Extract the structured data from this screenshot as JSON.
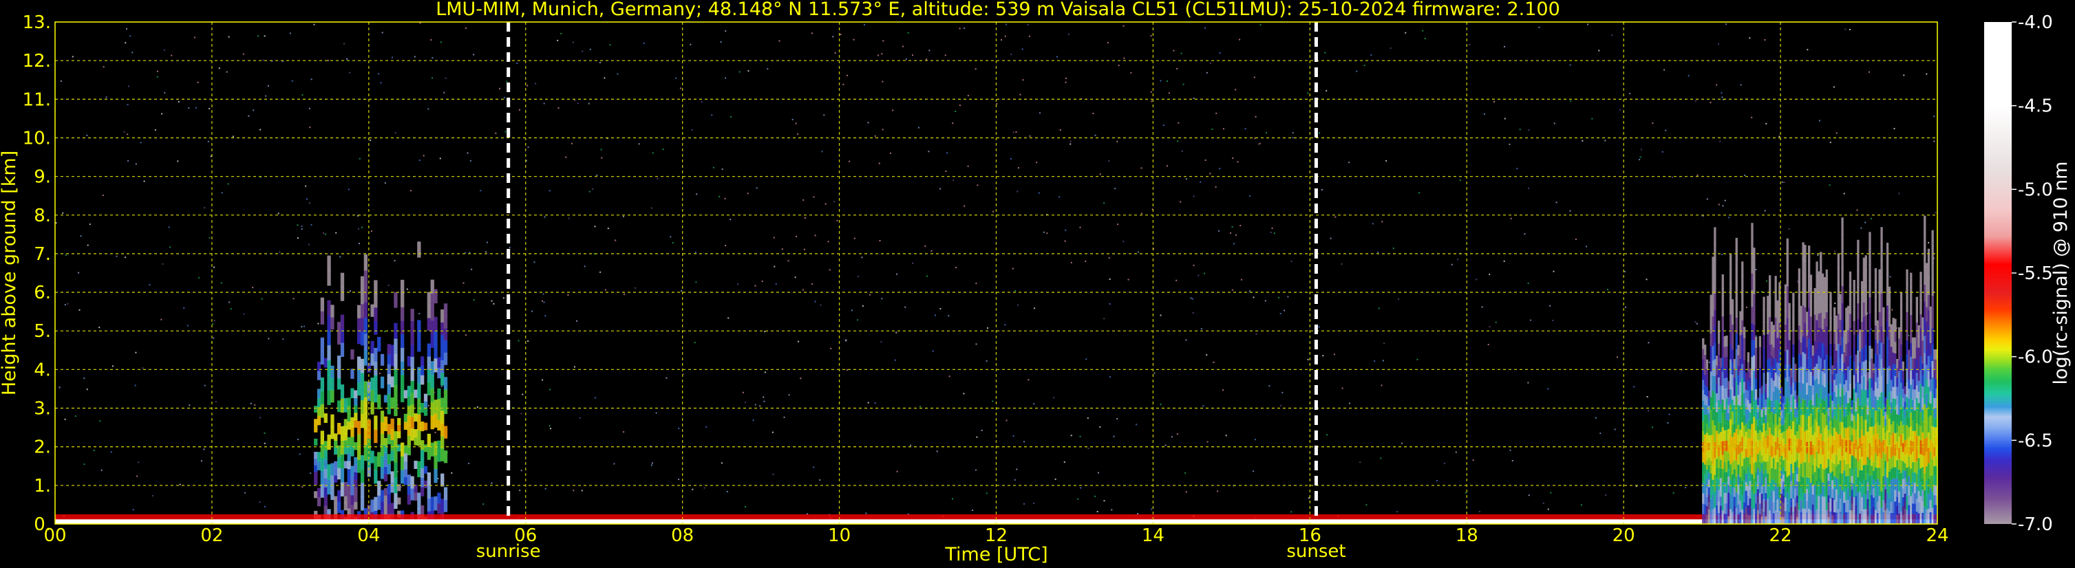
{
  "chart_data": {
    "type": "heatmap",
    "title": "LMU-MIM, Munich, Germany; 48.148° N 11.573° E, altitude: 539 m    Vaisala CL51 (CL51LMU): 25-10-2024    firmware: 2.100",
    "xlabel": "Time [UTC]",
    "ylabel": "Height above ground [km]",
    "xlim": [
      0,
      24
    ],
    "ylim": [
      0,
      13
    ],
    "x_ticks": [
      "00",
      "02",
      "04",
      "06",
      "08",
      "10",
      "12",
      "14",
      "16",
      "18",
      "20",
      "22",
      "24"
    ],
    "y_ticks": [
      "0.",
      "1.",
      "2.",
      "3.",
      "4.",
      "5.",
      "6.",
      "7.",
      "8.",
      "9.",
      "10.",
      "11.",
      "12.",
      "13."
    ],
    "grid": true,
    "grid_style": "dashed",
    "background": "#000000",
    "markers": [
      {
        "label": "sunrise",
        "x": 5.78
      },
      {
        "label": "sunset",
        "x": 16.08
      }
    ],
    "colorbar": {
      "label": "log(rc-signal) @ 910 nm",
      "range": [
        -7.0,
        -4.0
      ],
      "ticks": [
        "-4.0",
        "-4.5",
        "-5.0",
        "-5.5",
        "-6.0",
        "-6.5",
        "-7.0"
      ],
      "colors": [
        "#a89aa6",
        "#7a4f96",
        "#5a2aa0",
        "#3a2cc8",
        "#2450e8",
        "#5a86f0",
        "#8ab0f0",
        "#b0c8f0",
        "#3a9ee0",
        "#22c8a0",
        "#20c060",
        "#50d040",
        "#a0e020",
        "#e8f010",
        "#ffd000",
        "#ffa000",
        "#ff7000",
        "#ff3a00",
        "#e82020",
        "#ff0000",
        "#f0a0a0",
        "#f4c8c8",
        "#e8e0e0",
        "#ffffff"
      ],
      "color_stops": [
        -7.0,
        -6.85,
        -6.72,
        -6.62,
        -6.55,
        -6.48,
        -6.42,
        -6.36,
        -6.3,
        -6.22,
        -6.15,
        -6.08,
        -6.02,
        -5.96,
        -5.9,
        -5.84,
        -5.78,
        -5.72,
        -5.62,
        -5.45,
        -5.28,
        -5.12,
        -4.88,
        -4.5
      ]
    },
    "features": [
      {
        "name": "aerosol-plumes",
        "x_range": [
          3.3,
          5.0
        ],
        "y_top": 7.5,
        "peak_height": 2.5
      },
      {
        "name": "surface-layer",
        "x_range": [
          0,
          24
        ],
        "y_top": 0.25
      },
      {
        "name": "evening-layer",
        "x_range": [
          21.0,
          24.0
        ],
        "y_top": 8.0,
        "peak_height": 2.0
      }
    ]
  }
}
